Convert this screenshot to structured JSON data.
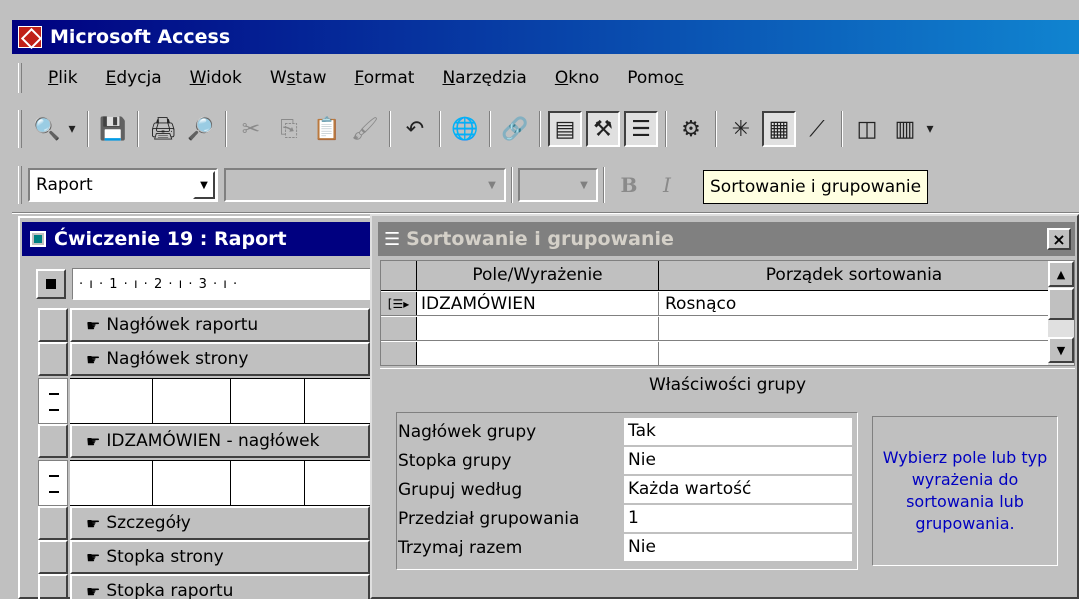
{
  "app": {
    "title": "Microsoft Access"
  },
  "menu": {
    "items": [
      {
        "pre": "",
        "u": "P",
        "post": "lik"
      },
      {
        "pre": "",
        "u": "E",
        "post": "dycja"
      },
      {
        "pre": "",
        "u": "W",
        "post": "idok"
      },
      {
        "pre": "W",
        "u": "s",
        "post": "taw"
      },
      {
        "pre": "",
        "u": "F",
        "post": "ormat"
      },
      {
        "pre": "",
        "u": "N",
        "post": "arzędzia"
      },
      {
        "pre": "",
        "u": "O",
        "post": "kno"
      },
      {
        "pre": "Pomo",
        "u": "c",
        "post": ""
      }
    ]
  },
  "toolbar": {
    "object_combo_value": "Raport",
    "tooltip": "Sortowanie i grupowanie",
    "bold_label": "B",
    "italic_label": "I"
  },
  "report_window": {
    "title": "Ćwiczenie 19 : Raport",
    "ruler": "· ı · 1 · ı · 2 · ı · 3 · ı ·",
    "sections": [
      "Nagłówek raportu",
      "Nagłówek strony",
      "IDZAMÓWIEN - nagłówek",
      "Szczegóły",
      "Stopka strony",
      "Stopka raportu"
    ]
  },
  "sort_dialog": {
    "title": "Sortowanie i grupowanie",
    "close_label": "×",
    "columns": [
      "Pole/Wyrażenie",
      "Porządek sortowania"
    ],
    "rows": [
      {
        "field": "IDZAMÓWIEN",
        "order": "Rosnąco"
      },
      {
        "field": "",
        "order": ""
      },
      {
        "field": "",
        "order": ""
      }
    ],
    "group_props_label": "Właściwości grupy",
    "properties": [
      {
        "label": "Nagłówek grupy",
        "value": "Tak"
      },
      {
        "label": "Stopka grupy",
        "value": "Nie"
      },
      {
        "label": "Grupuj według",
        "value": "Każda wartość"
      },
      {
        "label": "Przedział grupowania",
        "value": "1"
      },
      {
        "label": "Trzymaj razem",
        "value": "Nie"
      }
    ],
    "help_text": "Wybierz pole lub typ wyrażenia do sortowania lub grupowania."
  },
  "colors": {
    "active_title": "#000080",
    "inactive_title": "#808080",
    "face": "#c0c0c0",
    "help_text": "#0000c0",
    "tooltip_bg": "#ffffe1"
  }
}
